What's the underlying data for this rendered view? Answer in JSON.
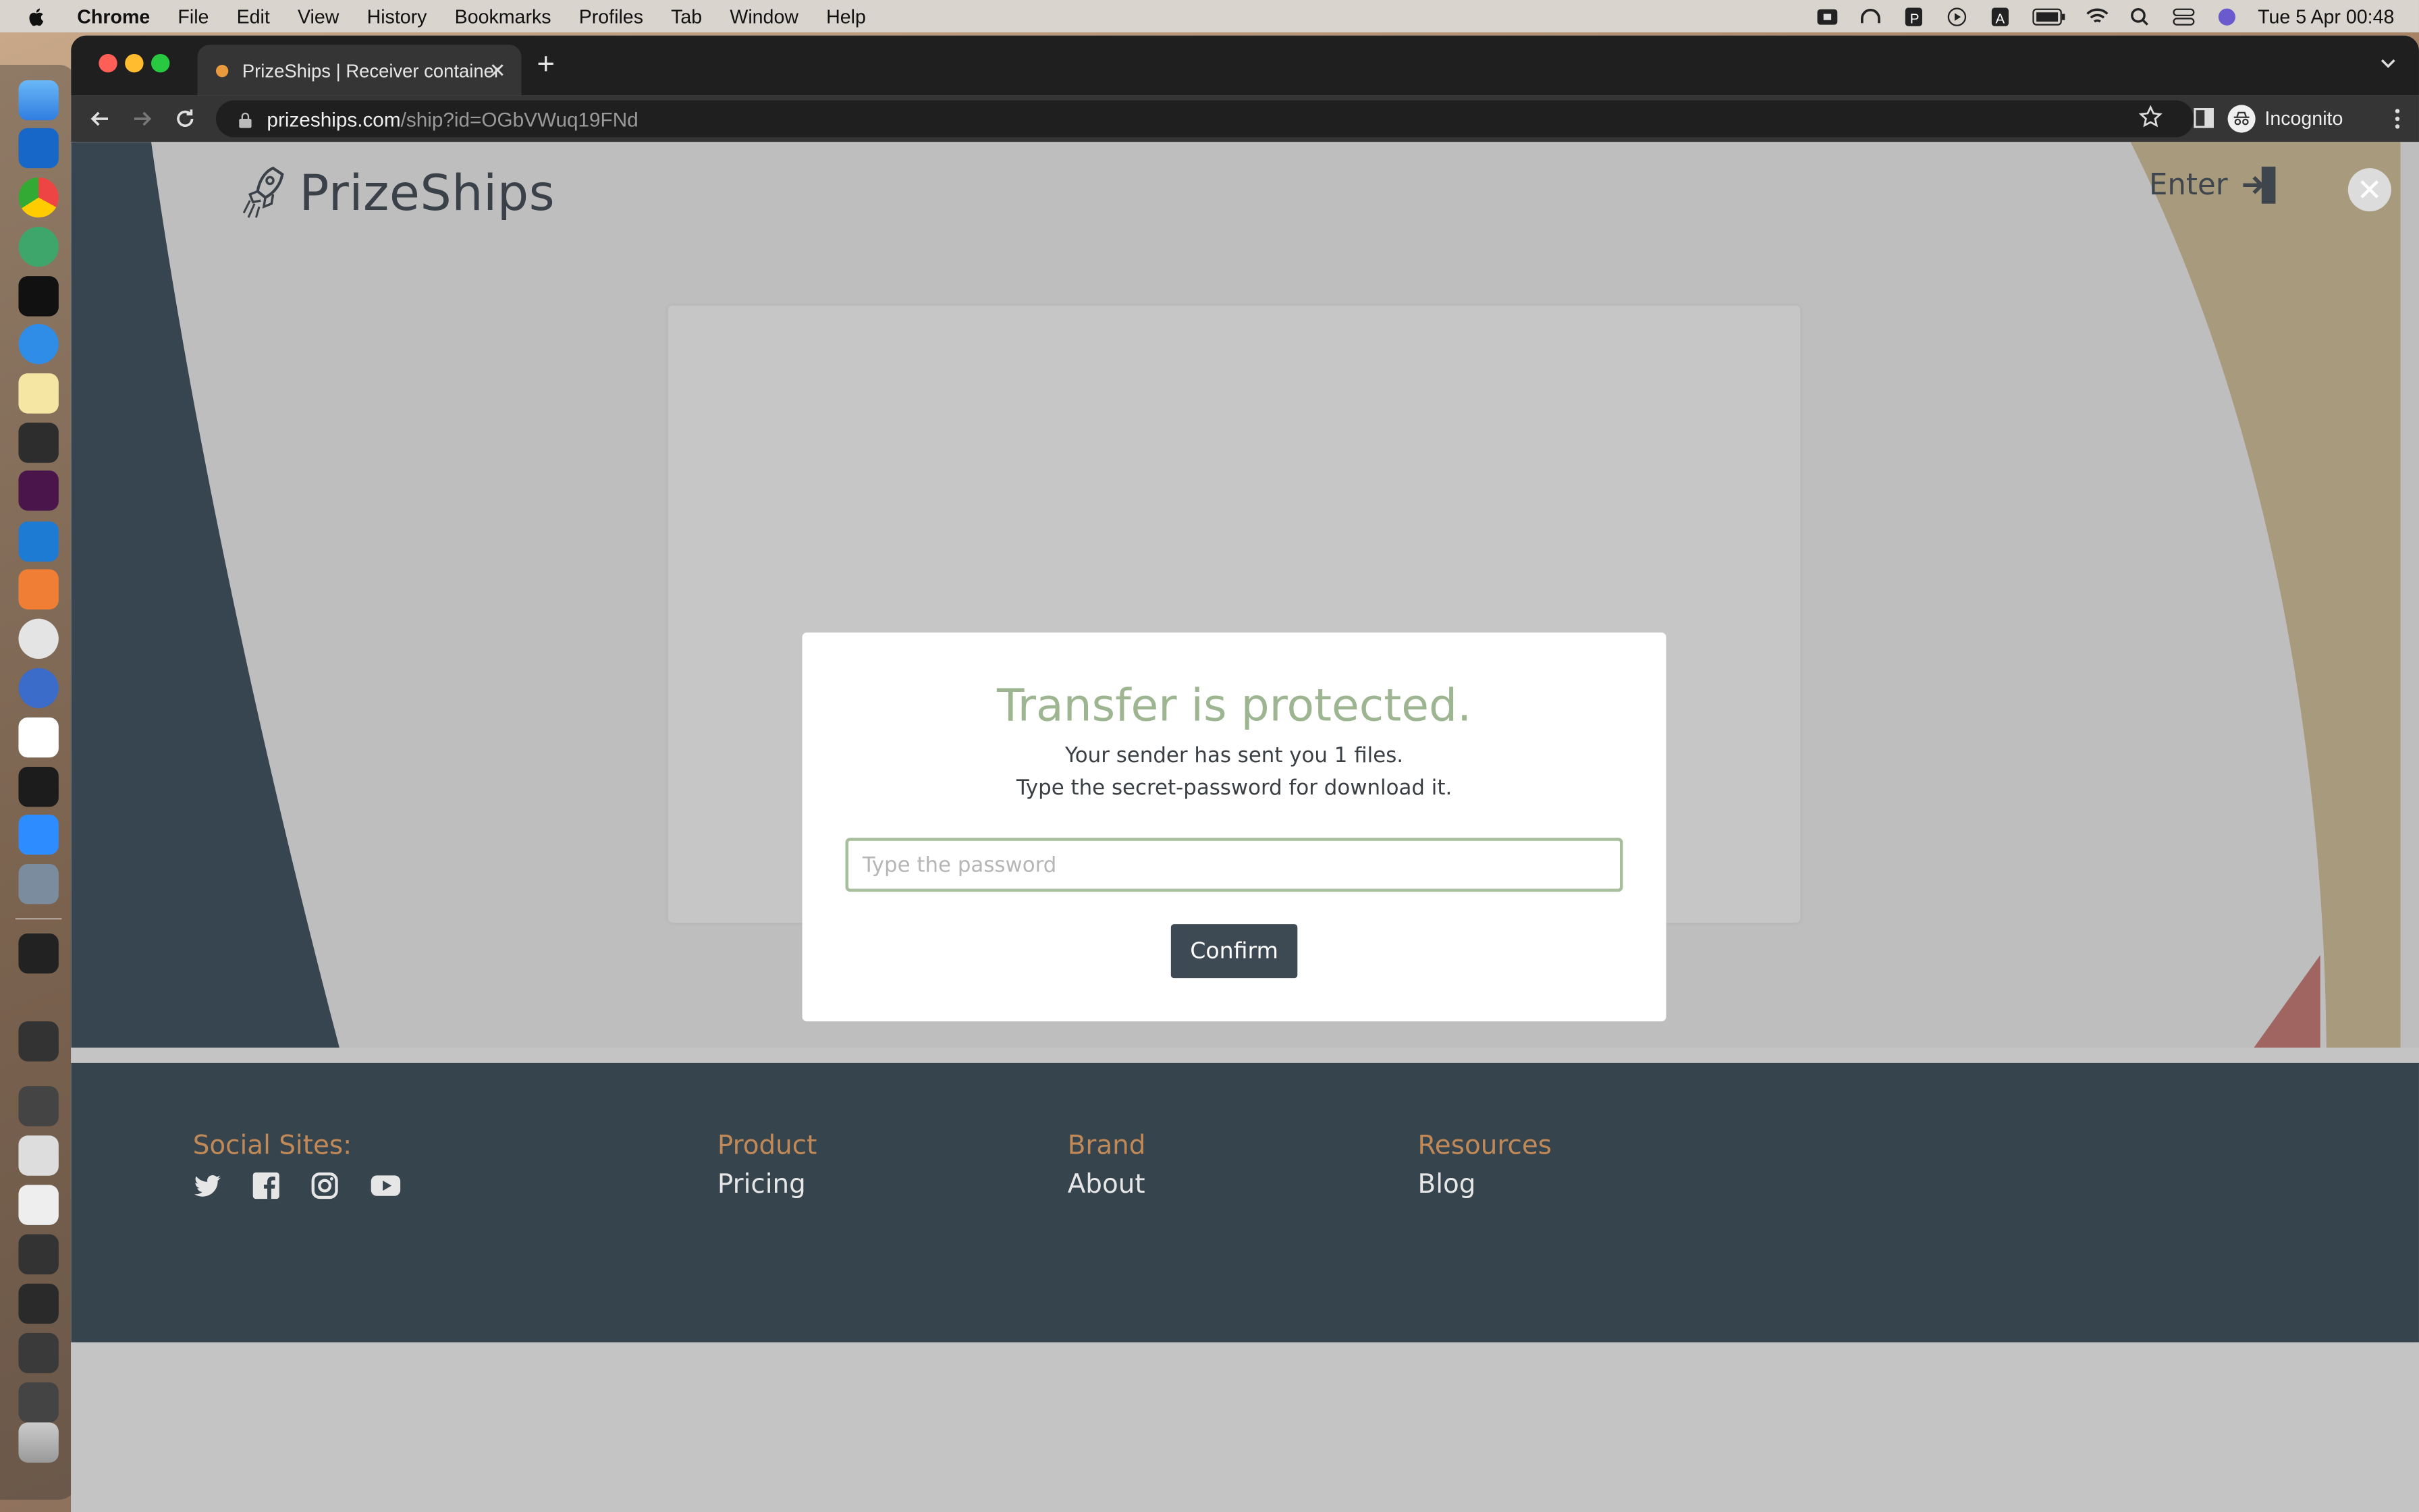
{
  "menubar": {
    "app": "Chrome",
    "items": [
      "File",
      "Edit",
      "View",
      "History",
      "Bookmarks",
      "Profiles",
      "Tab",
      "Window",
      "Help"
    ],
    "clock": "Tue 5 Apr  00:48"
  },
  "browser": {
    "tab_title": "PrizeShips | Receiver container",
    "url_host": "prizeships.com",
    "url_path": "/ship?id=OGbVWuq19FNd",
    "profile": "Incognito"
  },
  "site": {
    "brand": "PrizeShips",
    "enter_label": "Enter"
  },
  "modal": {
    "title": "Transfer is protected.",
    "line1": "Your sender has sent you 1 files.",
    "line2": "Type the secret-password for download it.",
    "password_placeholder": "Type the password",
    "confirm_label": "Confirm"
  },
  "footer": {
    "social_heading": "Social Sites:",
    "columns": [
      {
        "heading": "Product",
        "link": "Pricing"
      },
      {
        "heading": "Brand",
        "link": "About"
      },
      {
        "heading": "Resources",
        "link": "Blog"
      }
    ],
    "social_icons": [
      "twitter-icon",
      "facebook-icon",
      "instagram-icon",
      "youtube-icon"
    ]
  },
  "colors": {
    "accent_green": "#9db591",
    "footer_bg": "#36444d",
    "footer_heading": "#c08957",
    "button_bg": "#3d4a54"
  }
}
